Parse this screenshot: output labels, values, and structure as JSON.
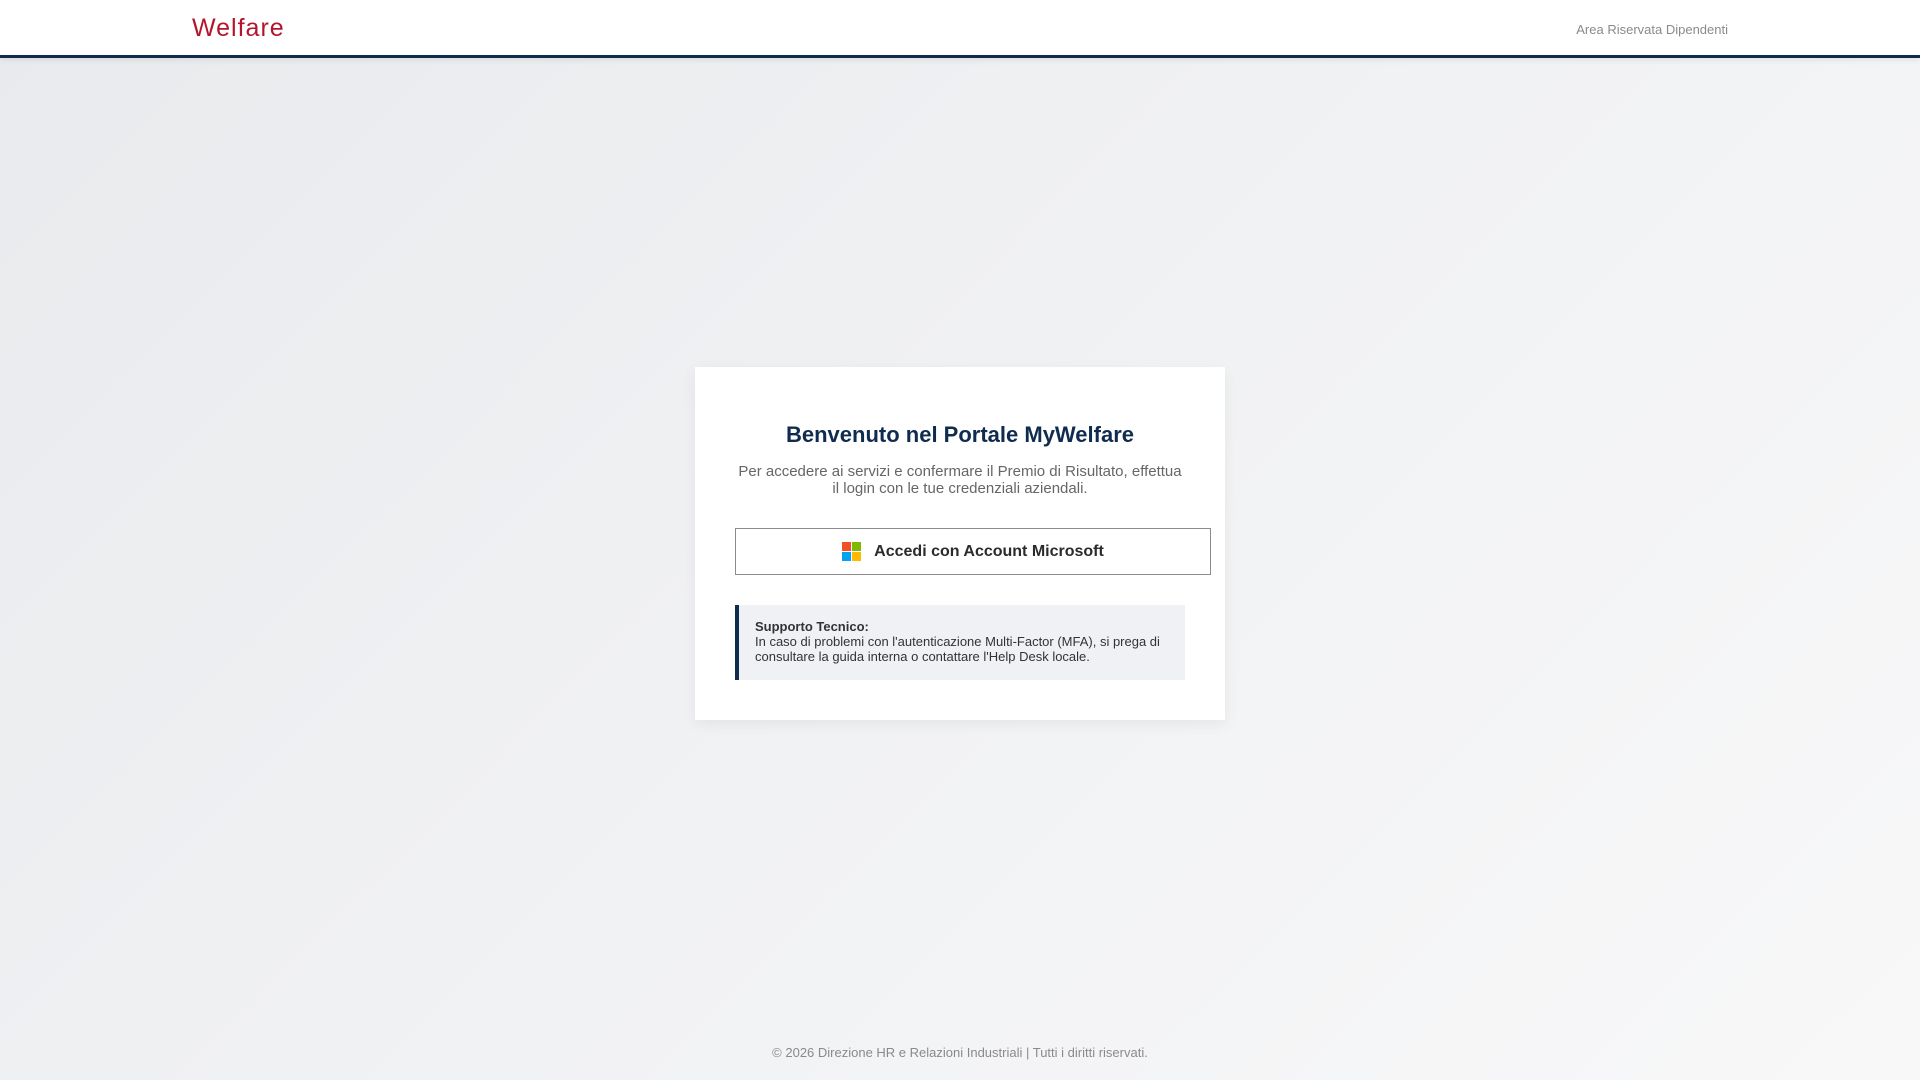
{
  "header": {
    "brand": "Welfare",
    "area_label": "Area Riservata Dipendenti"
  },
  "login_card": {
    "title": "Benvenuto nel Portale MyWelfare",
    "subtitle": "Per accedere ai servizi e confermare il Premio di Risultato, effettua il login con le tue credenziali aziendali.",
    "microsoft_button": {
      "label": "Accedi con Account Microsoft",
      "icon": "microsoft-logo-icon",
      "logo_colors": [
        "#f25022",
        "#7fba00",
        "#00a4ef",
        "#ffb900"
      ]
    },
    "support": {
      "title": "Supporto Tecnico:",
      "text": "In caso di problemi con l'autenticazione Multi-Factor (MFA), si prega di consultare la guida interna o contattare l'Help Desk locale."
    }
  },
  "footer": {
    "text": "© 2026 Direzione HR e Relazioni Industriali | Tutti i diritti riservati."
  },
  "colors": {
    "brand": "#b5152b",
    "primary": "#0f2c4f"
  }
}
